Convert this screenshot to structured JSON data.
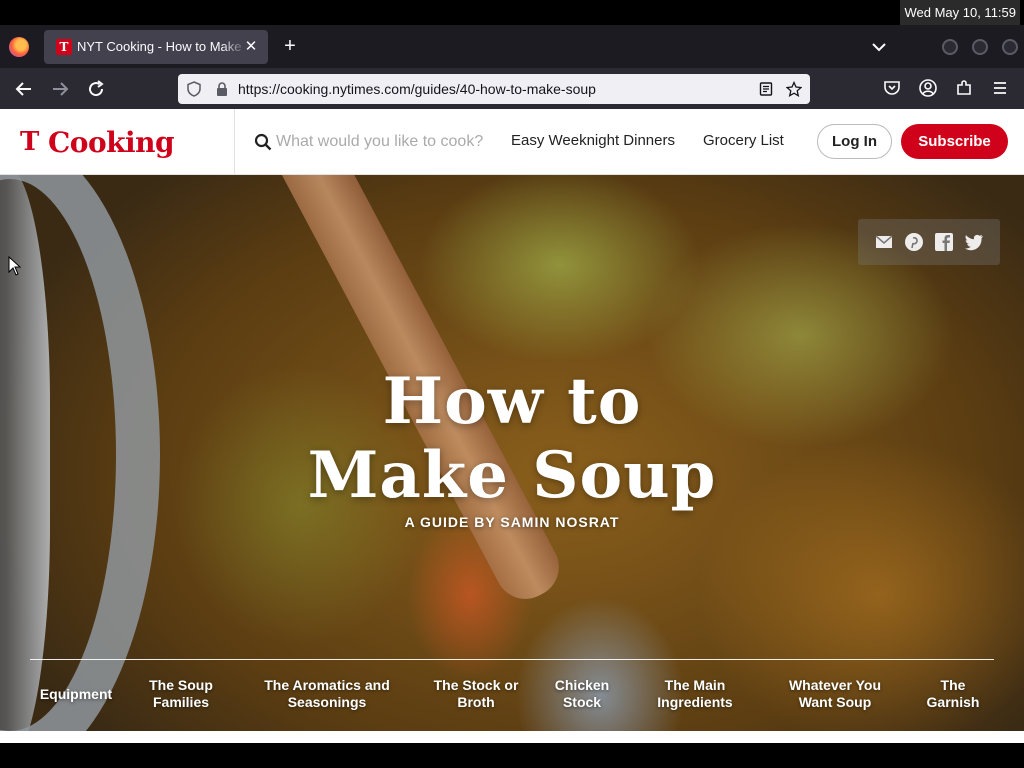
{
  "os": {
    "clock": "Wed May 10, 11:59"
  },
  "browser": {
    "tab": {
      "title": "NYT Cooking - How to Make Soup",
      "favicon": "T"
    },
    "url": {
      "prefix": "https://cooking.",
      "domain": "nytimes.com",
      "path": "/guides/40-how-to-make-soup"
    }
  },
  "header": {
    "logo_mark": "T",
    "logo_text": "Cooking",
    "search_placeholder": "What would you like to cook?",
    "links": [
      "Easy Weeknight Dinners",
      "Grocery List"
    ],
    "login": "Log In",
    "subscribe": "Subscribe",
    "brand_color": "#d0021b"
  },
  "hero": {
    "title_line1": "How to",
    "title_line2": "Make Soup",
    "subtitle": "A GUIDE BY SAMIN NOSRAT",
    "share_icons": [
      "email-icon",
      "pinterest-icon",
      "facebook-icon",
      "twitter-icon"
    ],
    "nav": [
      {
        "line1": "Equipment",
        "line2": ""
      },
      {
        "line1": "The Soup",
        "line2": "Families"
      },
      {
        "line1": "The Aromatics and",
        "line2": "Seasonings"
      },
      {
        "line1": "The Stock or",
        "line2": "Broth"
      },
      {
        "line1": "Chicken",
        "line2": "Stock"
      },
      {
        "line1": "The Main",
        "line2": "Ingredients"
      },
      {
        "line1": "Whatever You",
        "line2": "Want Soup"
      },
      {
        "line1": "The",
        "line2": "Garnish"
      }
    ]
  }
}
